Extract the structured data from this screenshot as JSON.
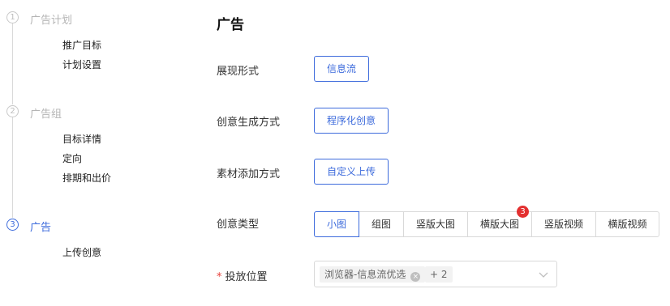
{
  "steps": [
    {
      "index": "1",
      "title": "广告计划",
      "active": false,
      "items": [
        "推广目标",
        "计划设置"
      ]
    },
    {
      "index": "2",
      "title": "广告组",
      "active": false,
      "items": [
        "目标详情",
        "定向",
        "排期和出价"
      ]
    },
    {
      "index": "3",
      "title": "广告",
      "active": true,
      "items": [
        "上传创意"
      ]
    }
  ],
  "page": {
    "title": "广告"
  },
  "form": {
    "display_format": {
      "label": "展现形式",
      "value": "信息流"
    },
    "creative_generation": {
      "label": "创意生成方式",
      "value": "程序化创意"
    },
    "material_add": {
      "label": "素材添加方式",
      "value": "自定义上传"
    },
    "creative_type": {
      "label": "创意类型",
      "options": [
        "小图",
        "组图",
        "竖版大图",
        "横版大图",
        "竖版视频",
        "横版视频"
      ],
      "selected": "小图",
      "badge": {
        "option": "横版大图",
        "count": "3"
      }
    },
    "placement": {
      "required_mark": "*",
      "label": "投放位置",
      "selected_tag": "浏览器-信息流优选",
      "more_tag": "+ 2"
    }
  },
  "colors": {
    "accent": "#3d6bdc",
    "badge": "#e33030",
    "required": "#e8413b",
    "inactive_step": "#b5b5b5"
  },
  "icons": {
    "tag_close": "close-circle-icon",
    "select_arrow": "chevron-down-icon"
  }
}
